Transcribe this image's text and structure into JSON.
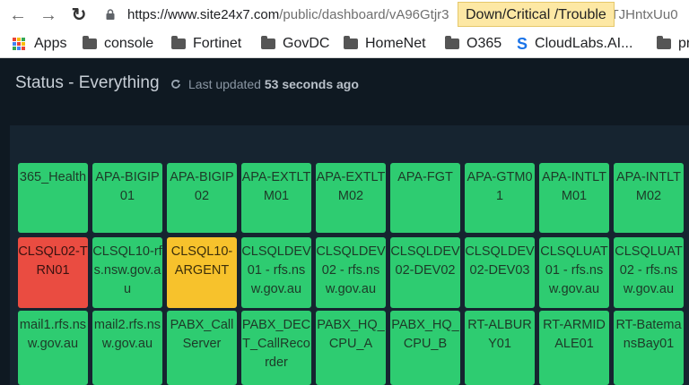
{
  "browser": {
    "url_host": "https://www.site24x7.com",
    "url_path": "/public/dashboard/vA96Gtjr3",
    "url_tail": "TJHntxUu0",
    "tooltip": "Down/Critical /Trouble"
  },
  "bookmarks": [
    {
      "label": "Apps",
      "icon": "apps-grid-icon"
    },
    {
      "label": "console",
      "icon": "folder-icon"
    },
    {
      "label": "Fortinet",
      "icon": "folder-icon"
    },
    {
      "label": "GovDC",
      "icon": "folder-icon"
    },
    {
      "label": "HomeNet",
      "icon": "folder-icon"
    },
    {
      "label": "O365",
      "icon": "folder-icon"
    },
    {
      "label": "CloudLabs.AI...",
      "icon": "s-logo-icon"
    },
    {
      "label": "pr",
      "icon": "folder-icon"
    }
  ],
  "dashboard": {
    "title": "Status - Everything",
    "updated_prefix": "Last updated",
    "updated_value": "53 seconds ago"
  },
  "status_colors": {
    "up": "#2ecc71",
    "down": "#ea4c41",
    "trouble": "#f7c22c"
  },
  "tiles": [
    [
      {
        "label": "365_Health",
        "status": "up"
      },
      {
        "label": "APA-BIGIP01",
        "status": "up"
      },
      {
        "label": "APA-BIGIP02",
        "status": "up"
      },
      {
        "label": "APA-EXTLTM01",
        "status": "up"
      },
      {
        "label": "APA-EXTLTM02",
        "status": "up"
      },
      {
        "label": "APA-FGT",
        "status": "up"
      },
      {
        "label": "APA-GTM01",
        "status": "up"
      },
      {
        "label": "APA-INTLTM01",
        "status": "up"
      },
      {
        "label": "APA-INTLTM02",
        "status": "up"
      }
    ],
    [
      {
        "label": "CLSQL02-TRN01",
        "status": "down"
      },
      {
        "label": "CLSQL10-rfs.nsw.gov.au",
        "status": "up"
      },
      {
        "label": "CLSQL10-ARGENT",
        "status": "trouble"
      },
      {
        "label": "CLSQLDEV01 - rfs.nsw.gov.au",
        "status": "up"
      },
      {
        "label": "CLSQLDEV02 - rfs.nsw.gov.au",
        "status": "up"
      },
      {
        "label": "CLSQLDEV02-DEV02",
        "status": "up"
      },
      {
        "label": "CLSQLDEV02-DEV03",
        "status": "up"
      },
      {
        "label": "CLSQLUAT01 - rfs.nsw.gov.au",
        "status": "up"
      },
      {
        "label": "CLSQLUAT02 - rfs.nsw.gov.au",
        "status": "up"
      }
    ],
    [
      {
        "label": "mail1.rfs.nsw.gov.au",
        "status": "up"
      },
      {
        "label": "mail2.rfs.nsw.gov.au",
        "status": "up"
      },
      {
        "label": "PABX_CallServer",
        "status": "up"
      },
      {
        "label": "PABX_DECT_CallRecorder",
        "status": "up"
      },
      {
        "label": "PABX_HQ_CPU_A",
        "status": "up"
      },
      {
        "label": "PABX_HQ_CPU_B",
        "status": "up"
      },
      {
        "label": "RT-ALBURY01",
        "status": "up"
      },
      {
        "label": "RT-ARMIDALE01",
        "status": "up"
      },
      {
        "label": "RT-BatemansBay01",
        "status": "up"
      }
    ]
  ]
}
